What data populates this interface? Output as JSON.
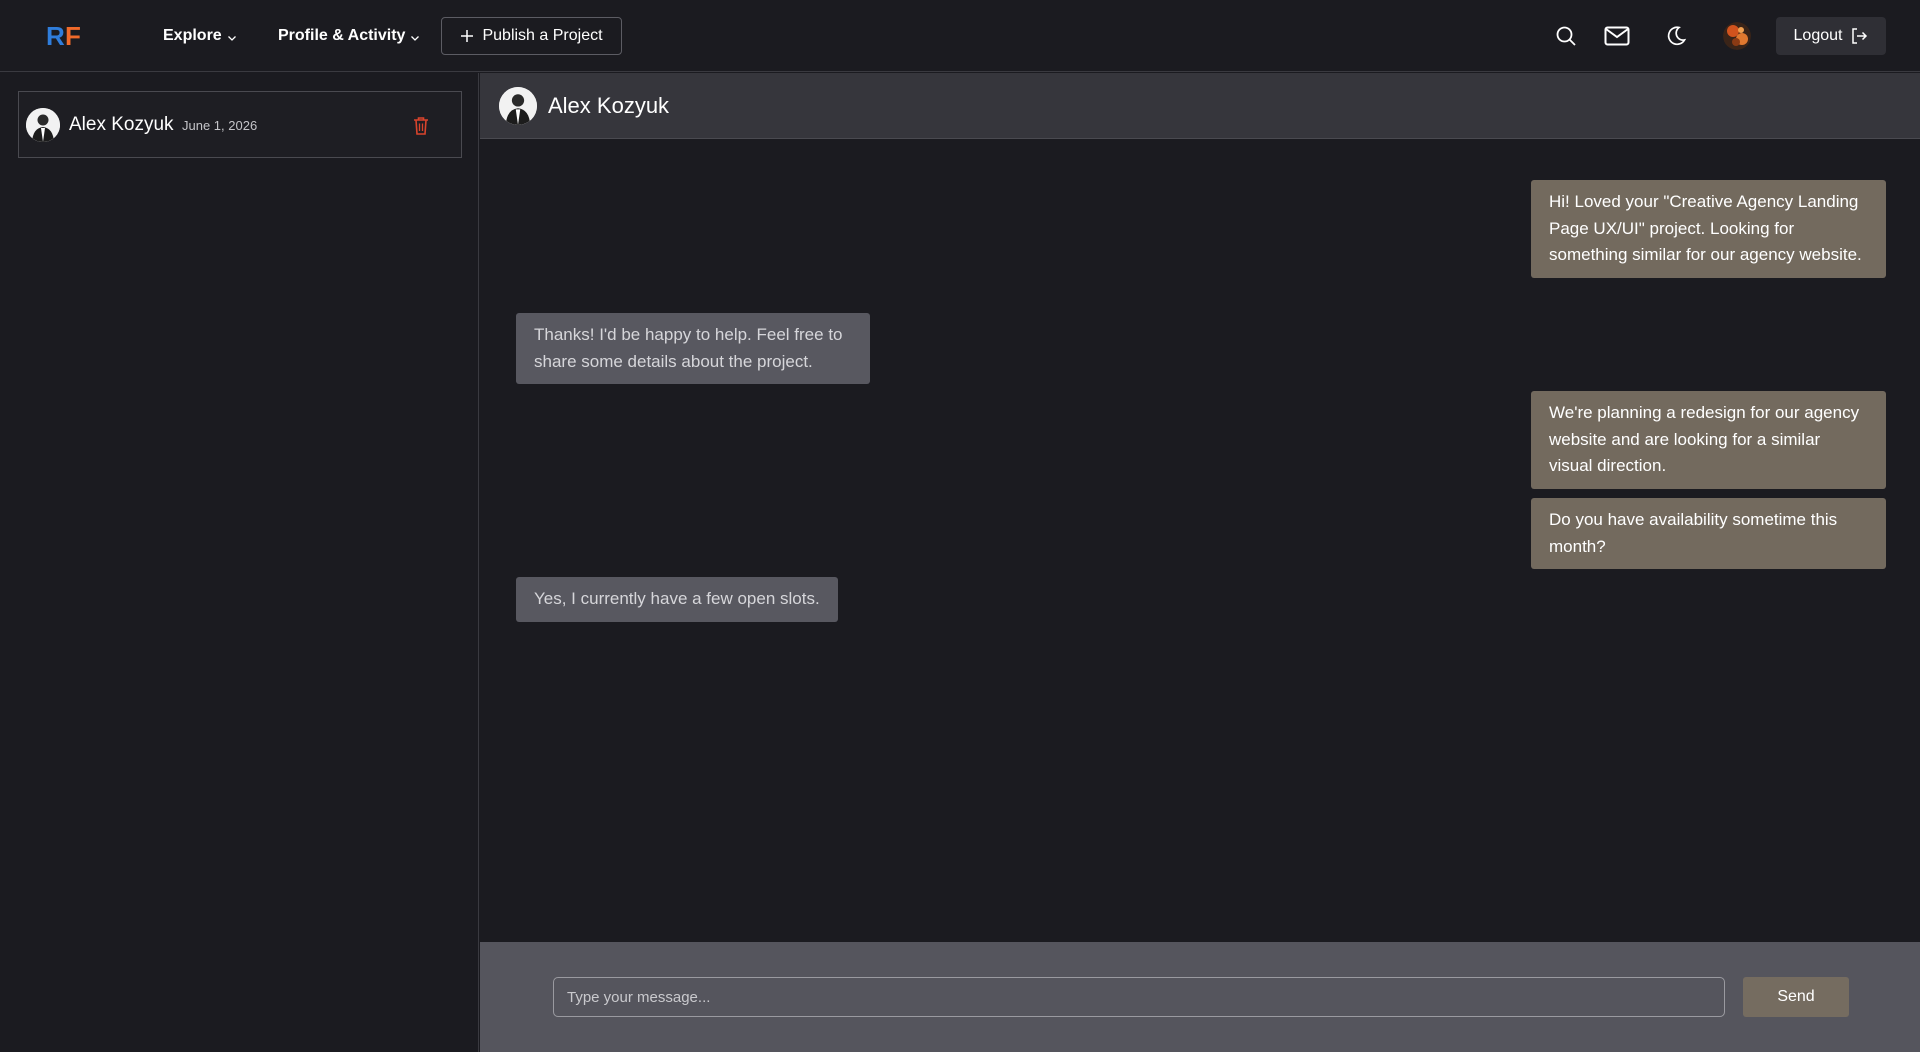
{
  "nav": {
    "logo_text": "RF",
    "explore_label": "Explore",
    "profile_label": "Profile & Activity",
    "publish_label": "Publish a Project",
    "logout_label": "Logout",
    "icons": [
      "search-icon",
      "mail-icon",
      "moon-icon",
      "user-avatar",
      "logout-icon"
    ]
  },
  "sidebar": {
    "conversations": [
      {
        "name": "Alex Kozyuk",
        "date": "June 1, 2026"
      }
    ]
  },
  "chat": {
    "contact_name": "Alex Kozyuk",
    "messages": [
      {
        "direction": "out",
        "text": "Hi! Loved your \"Creative Agency Landing Page UX/UI\" project. Looking for something similar for our agency website."
      },
      {
        "direction": "in",
        "text": "Thanks! I'd be happy to help. Feel free to share some details about the project."
      },
      {
        "direction": "out",
        "text": "We're planning a redesign for our agency website and are looking for a similar visual direction."
      },
      {
        "direction": "out",
        "text": "Do you have availability sometime this month?"
      },
      {
        "direction": "in",
        "text": "Yes, I currently have a few open slots."
      }
    ]
  },
  "composer": {
    "placeholder": "Type your message...",
    "value": "",
    "send_label": "Send"
  },
  "colors": {
    "background": "#1b1b20",
    "outgoing_bubble": "#736a5e",
    "incoming_bubble": "#585860",
    "logo_blue": "#2f7ddb",
    "logo_orange": "#f06a2a",
    "delete_red": "#d9442c"
  }
}
